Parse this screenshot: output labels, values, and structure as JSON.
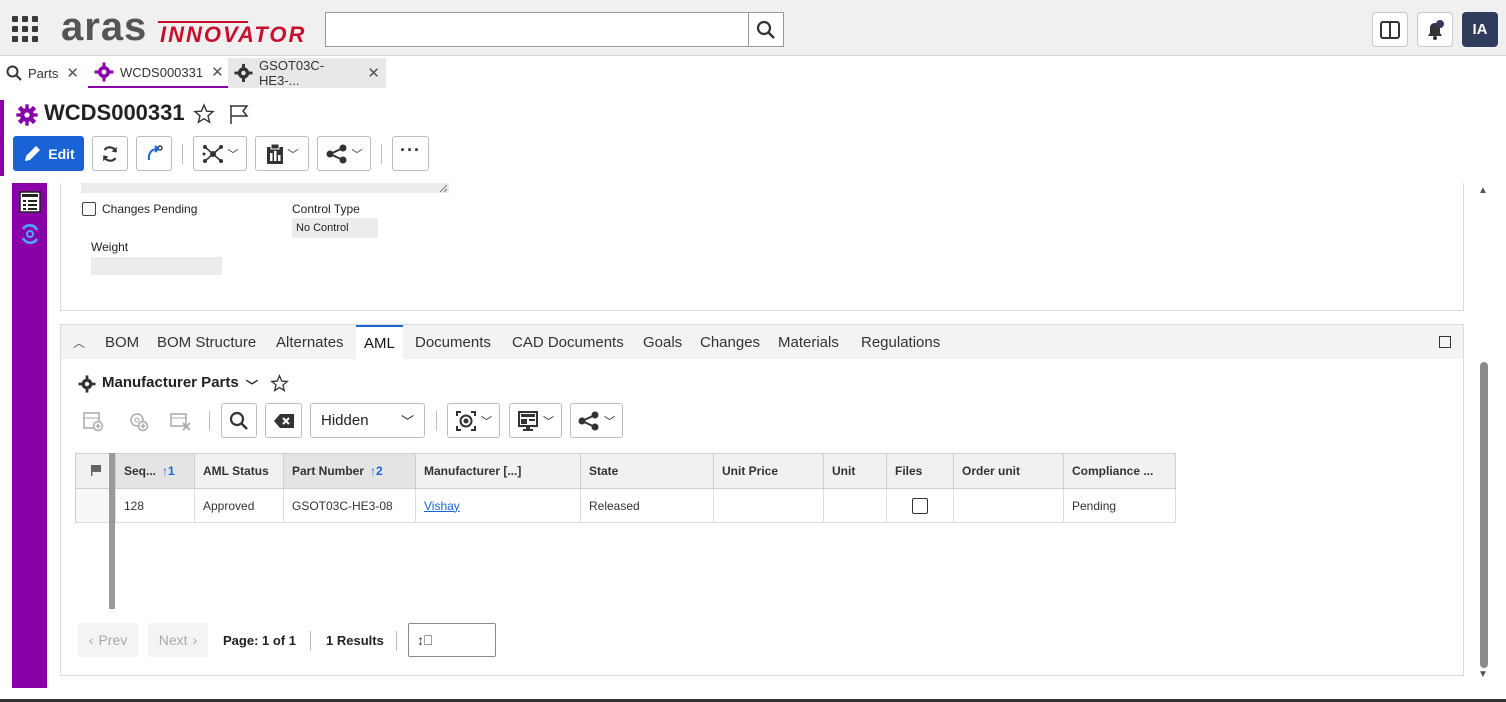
{
  "header": {
    "logo_left": "aras",
    "logo_right": "INNOVATOR",
    "search_placeholder": "",
    "avatar_initials": "IA"
  },
  "tabs": [
    {
      "label": "Parts"
    },
    {
      "label": "WCDS000331"
    },
    {
      "label": "GSOT03C-HE3-..."
    }
  ],
  "item": {
    "title": "WCDS000331",
    "edit_label": "Edit"
  },
  "form": {
    "changes_pending_label": "Changes Pending",
    "control_type_label": "Control Type",
    "control_type_value": "No Control",
    "weight_label": "Weight",
    "weight_value": ""
  },
  "relationship_tabs": [
    "BOM",
    "BOM Structure",
    "Alternates",
    "AML",
    "Documents",
    "CAD Documents",
    "Goals",
    "Changes",
    "Materials",
    "Regulations"
  ],
  "relationship_tab_active": "AML",
  "grid_panel": {
    "title": "Manufacturer Parts",
    "filter_select": "Hidden",
    "columns": [
      "Seq...",
      "AML Status",
      "Part Number",
      "Manufacturer [...]",
      "State",
      "Unit Price",
      "Unit",
      "Files",
      "Order unit",
      "Compliance ..."
    ],
    "sort_seq": "1",
    "sort_part": "2",
    "rows": [
      {
        "seq": "128",
        "aml_status": "Approved",
        "part_number": "GSOT03C-HE3-08",
        "manufacturer": "Vishay",
        "state": "Released",
        "unit_price": "",
        "unit": "",
        "files_checked": false,
        "order_unit": "",
        "compliance": "Pending"
      }
    ]
  },
  "pager": {
    "prev": "Prev",
    "next": "Next",
    "page": "Page: 1 of 1",
    "results": "1 Results",
    "page_size_value": ""
  },
  "colors": {
    "accent_purple": "#8a00a8",
    "primary_blue": "#1a63d6",
    "logo_red": "#c8102e"
  }
}
